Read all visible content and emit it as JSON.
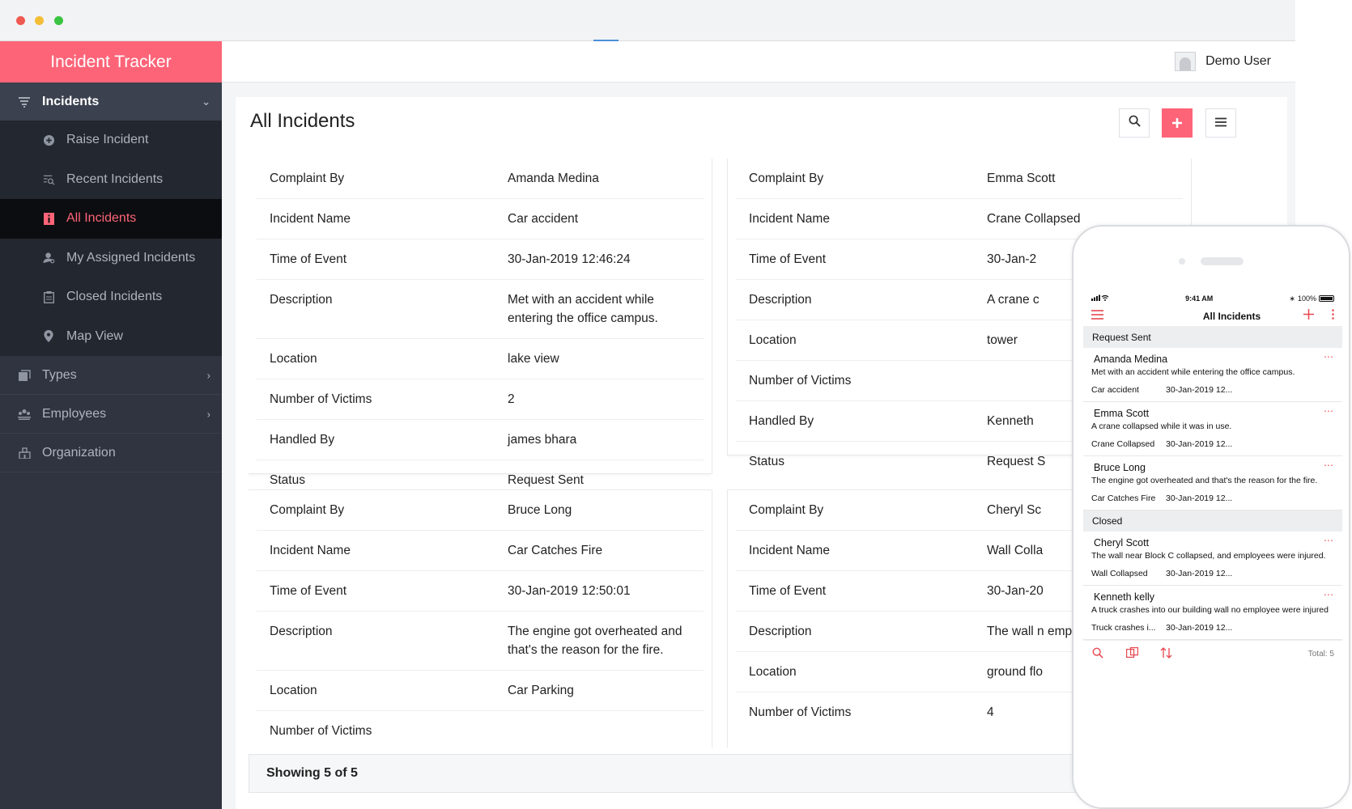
{
  "app": {
    "brand": "Incident Tracker",
    "user": "Demo User"
  },
  "sidebar": {
    "group": "Incidents",
    "items": [
      {
        "label": "Raise Incident",
        "icon": "plus-circle-icon"
      },
      {
        "label": "Recent Incidents",
        "icon": "recent-list-icon"
      },
      {
        "label": "All Incidents",
        "icon": "info-icon",
        "active": true
      },
      {
        "label": "My Assigned Incidents",
        "icon": "user-icon"
      },
      {
        "label": "Closed Incidents",
        "icon": "clipboard-icon"
      },
      {
        "label": "Map View",
        "icon": "map-pin-icon"
      }
    ],
    "top_items": [
      {
        "label": "Types",
        "icon": "layers-icon"
      },
      {
        "label": "Employees",
        "icon": "employees-icon"
      },
      {
        "label": "Organization",
        "icon": "building-icon"
      }
    ]
  },
  "page": {
    "title": "All Incidents",
    "footer": "Showing 5 of 5"
  },
  "cards": [
    {
      "rows": [
        {
          "k": "Complaint By",
          "v": "Amanda Medina"
        },
        {
          "k": "Incident Name",
          "v": "Car accident"
        },
        {
          "k": "Time of Event",
          "v": "30-Jan-2019 12:46:24"
        },
        {
          "k": "Description",
          "v": "Met with an accident while entering the office campus."
        },
        {
          "k": "Location",
          "v": "lake view"
        },
        {
          "k": "Number of Victims",
          "v": "2"
        },
        {
          "k": "Handled By",
          "v": "james bhara"
        },
        {
          "k": "Status",
          "v": "Request Sent"
        }
      ]
    },
    {
      "rows": [
        {
          "k": "Complaint By",
          "v": "Emma Scott"
        },
        {
          "k": "Incident Name",
          "v": "Crane Collapsed"
        },
        {
          "k": "Time of Event",
          "v": "30-Jan-2"
        },
        {
          "k": "Description",
          "v": "A crane c"
        },
        {
          "k": "Location",
          "v": "tower"
        },
        {
          "k": "Number of Victims",
          "v": ""
        },
        {
          "k": "Handled By",
          "v": "Kenneth"
        },
        {
          "k": "Status",
          "v": "Request S"
        }
      ]
    },
    {
      "rows": [
        {
          "k": "Complaint By",
          "v": "Bruce Long"
        },
        {
          "k": "Incident Name",
          "v": "Car Catches Fire"
        },
        {
          "k": "Time of Event",
          "v": "30-Jan-2019 12:50:01"
        },
        {
          "k": "Description",
          "v": "The engine got overheated and that's the reason for the fire."
        },
        {
          "k": "Location",
          "v": "Car Parking"
        },
        {
          "k": "Number of Victims",
          "v": ""
        }
      ]
    },
    {
      "rows": [
        {
          "k": "Complaint By",
          "v": "Cheryl Sc"
        },
        {
          "k": "Incident Name",
          "v": "Wall Colla"
        },
        {
          "k": "Time of Event",
          "v": "30-Jan-20"
        },
        {
          "k": "Description",
          "v": "The wall n employee"
        },
        {
          "k": "Location",
          "v": "ground flo"
        },
        {
          "k": "Number of Victims",
          "v": "4"
        }
      ]
    }
  ],
  "mobile": {
    "time": "9:41 AM",
    "battery": "100%",
    "title": "All Incidents",
    "sections": [
      {
        "header": "Request Sent",
        "items": [
          {
            "name": "Amanda Medina",
            "desc": "Met with an accident while entering the office campus.",
            "incident": "Car accident",
            "time": "30-Jan-2019 12..."
          },
          {
            "name": "Emma Scott",
            "desc": "A crane collapsed while it was in use.",
            "incident": "Crane Collapsed",
            "time": "30-Jan-2019 12..."
          },
          {
            "name": "Bruce Long",
            "desc": "The engine got overheated and that's the reason for the fire.",
            "incident": "Car Catches Fire",
            "time": "30-Jan-2019 12..."
          }
        ]
      },
      {
        "header": "Closed",
        "items": [
          {
            "name": "Cheryl Scott",
            "desc": "The wall near Block C collapsed, and employees were injured.",
            "incident": "Wall Collapsed",
            "time": "30-Jan-2019 12..."
          },
          {
            "name": "Kenneth kelly",
            "desc": "A truck crashes into our building wall no employee were injured",
            "incident": "Truck crashes i...",
            "time": "30-Jan-2019 12..."
          }
        ]
      }
    ],
    "total": "Total: 5"
  },
  "colors": {
    "accent": "#fd6478",
    "sidebar_bg": "#2f3440",
    "mobile_accent": "#e8474f"
  }
}
